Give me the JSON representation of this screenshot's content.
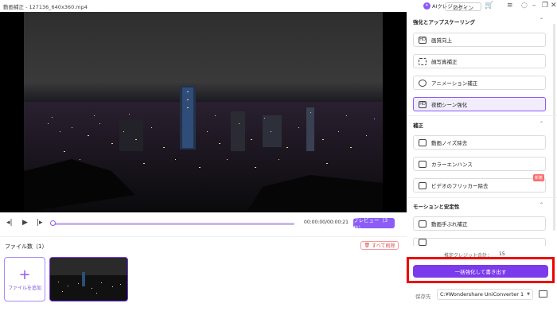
{
  "window": {
    "title": "動画補正 - 127136_640x360.mp4",
    "ai_credit_label": "AIクレジット：",
    "login_label": "ログイン"
  },
  "player": {
    "timecode": "00:00:00/00:00:21",
    "progress": 0,
    "preview_label": "プレビュー（3秒）"
  },
  "files": {
    "count_label": "ファイル数（1）",
    "delete_all_label": "すべて削除",
    "add_file_label": "ファイルを追加"
  },
  "panel": {
    "sections": [
      {
        "title": "強化とアップスケーリング",
        "options": [
          {
            "label": "画質向上",
            "icon": "hd-icon",
            "selected": false
          },
          {
            "label": "顔写真補正",
            "icon": "face-icon",
            "selected": false
          },
          {
            "label": "アニメーション補正",
            "icon": "anime-icon",
            "selected": false
          },
          {
            "label": "夜間シーン強化",
            "icon": "night-hd-icon",
            "selected": true
          }
        ]
      },
      {
        "title": "補正",
        "options": [
          {
            "label": "動画ノイズ除去",
            "icon": "denoise-icon",
            "selected": false
          },
          {
            "label": "カラーエンハンス",
            "icon": "color-icon",
            "selected": false
          },
          {
            "label": "ビデオのフリッカー除去",
            "icon": "flicker-icon",
            "selected": false,
            "badge": "新着"
          }
        ]
      },
      {
        "title": "モーションと安定性",
        "options": [
          {
            "label": "動画手ぶれ補正",
            "icon": "stabilize-icon",
            "selected": false
          }
        ]
      }
    ],
    "credit_total_label": "推定クレジット合計：",
    "credit_total_value": "15",
    "export_label": "一括強化して書き出す",
    "save_label": "保存先",
    "save_path": "C:¥Wondershare UniConverter 1"
  },
  "colors": {
    "accent": "#8b5cf6",
    "highlight": "#ee0000"
  }
}
